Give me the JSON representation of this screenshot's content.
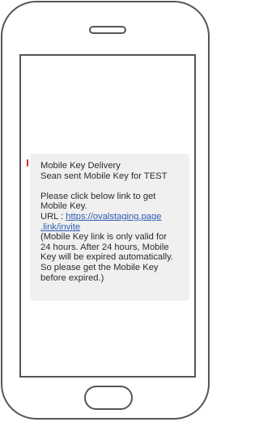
{
  "sms": {
    "title": "Mobile Key Delivery",
    "sender_line": "Sean sent Mobile Key for TEST",
    "instruction_1": "Please click below link to get",
    "instruction_2": "Mobile Key.",
    "url_label": "URL : ",
    "url_part_1": "https://ovalstaging.page",
    "url_part_2": ".link/invite",
    "note_1": "(Mobile Key link is only valid for",
    "note_2": "24 hours. After 24 hours, Mobile",
    "note_3": "Key will be expired automatically.",
    "note_4": "So please get the Mobile Key",
    "note_5": "before expired.)"
  },
  "colors": {
    "device_outline": "#555555",
    "bubble_background": "#f0f0f0",
    "link": "#2f5ab5",
    "tail_accent": "#d62d20"
  }
}
